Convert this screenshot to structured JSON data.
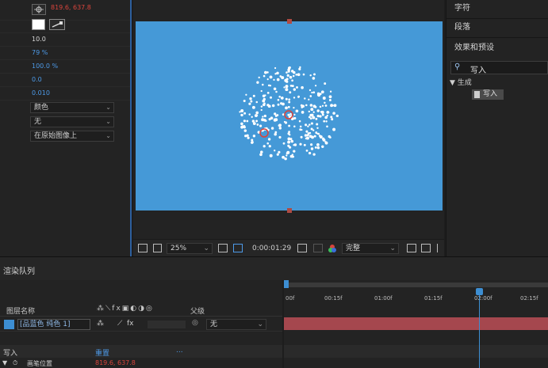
{
  "effect_controls": {
    "position_value": "819.6, 637.8",
    "number_1": "10.0",
    "percent_1": "79 %",
    "percent_2": "100.0 %",
    "number_2": "0.0",
    "number_3": "0.010",
    "dropdown_1": "颜色",
    "dropdown_2": "无",
    "dropdown_3": "在原始图像上"
  },
  "viewer_toolbar": {
    "zoom": "25%",
    "timecode": "0:00:01:29",
    "resolution": "完整"
  },
  "right_panel": {
    "characters": "字符",
    "paragraph": "段落",
    "effects_presets": "效果和预设",
    "search_value": "写入",
    "category": "生成",
    "effect_item": "写入"
  },
  "timeline": {
    "tab_label": "渲染队列",
    "col_layer_name": "图层名称",
    "col_parent": "父级",
    "layer_name": "[品蓝色 纯色 1]",
    "parent_value": "无",
    "effect_name": "写入",
    "effect_reset": "重置",
    "effect_dots": "...",
    "prop_name": "画笔位置",
    "prop_value": "819.6, 637.8",
    "ruler": [
      "00f",
      "00:15f",
      "01:00f",
      "01:15f",
      "02:00f",
      "02:15f"
    ]
  },
  "colors": {
    "canvas": "#4599d7",
    "accent_blue": "#4d9ae8",
    "value_red": "#d9443c"
  }
}
